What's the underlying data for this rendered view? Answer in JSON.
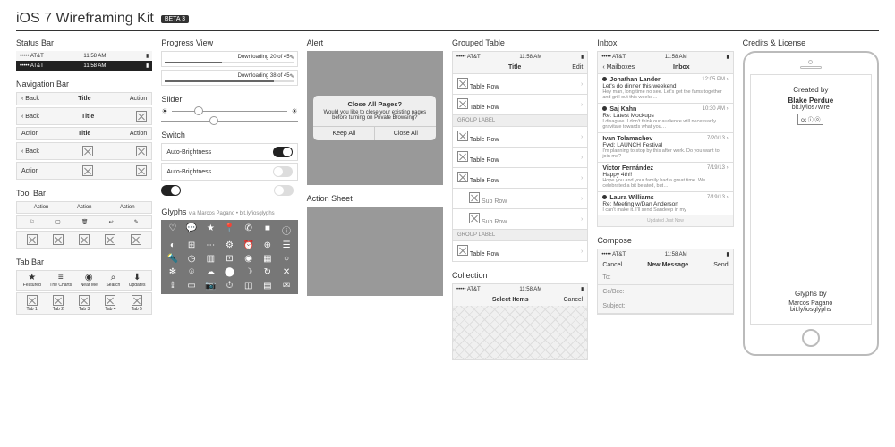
{
  "header": {
    "title": "iOS 7 Wireframing Kit",
    "badge": "BETA 3"
  },
  "sections": {
    "statusbar": "Status Bar",
    "navbar": "Navigation Bar",
    "toolbar": "Tool Bar",
    "tabbar": "Tab Bar",
    "progress": "Progress View",
    "slider": "Slider",
    "switch": "Switch",
    "glyphs": "Glyphs",
    "alert": "Alert",
    "actionsheet": "Action Sheet",
    "grouped": "Grouped Table",
    "collection": "Collection",
    "inbox": "Inbox",
    "compose": "Compose",
    "credits": "Credits & License"
  },
  "statusbar": {
    "carrier": "••••• AT&T",
    "wifi": "⦿",
    "time": "11:58 AM"
  },
  "navbar": {
    "back": "Back",
    "title": "Title",
    "action": "Action"
  },
  "toolbar": {
    "action": "Action"
  },
  "tabbar": {
    "labeled": [
      {
        "icon": "★",
        "label": "Featured"
      },
      {
        "icon": "≡",
        "label": "The Charts"
      },
      {
        "icon": "◉",
        "label": "Near Me"
      },
      {
        "icon": "⌕",
        "label": "Search"
      },
      {
        "icon": "⬇",
        "label": "Updates"
      }
    ],
    "generic": [
      "Tab 1",
      "Tab 2",
      "Tab 3",
      "Tab 4",
      "Tab 5"
    ]
  },
  "progress": [
    {
      "label": "Downloading 20 of 45",
      "pct": 44
    },
    {
      "label": "Downloading 38 of 45",
      "pct": 84
    }
  ],
  "switch": {
    "label": "Auto-Brightness"
  },
  "glyphs_credit": "via Marcos Pagano • bit.ly/iosglyphs",
  "alert": {
    "title": "Close All Pages?",
    "message": "Would you like to close your existing pages before turning on Private Browsing?",
    "buttons": [
      "Keep All",
      "Close All"
    ]
  },
  "grouped": {
    "nav_title": "Title",
    "nav_edit": "Edit",
    "row": "Table Row",
    "sub": "Sub Row",
    "label": "GROUP LABEL"
  },
  "collection": {
    "title": "Select Items",
    "cancel": "Cancel"
  },
  "inbox": {
    "back": "Mailboxes",
    "title": "Inbox",
    "items": [
      {
        "unread": true,
        "name": "Jonathan Lander",
        "time": "12:05 PM",
        "subj": "Let's do dinner this weekend",
        "prev": "Hey man, long time no see. Let's get the fams together and grill out this weeke…"
      },
      {
        "unread": true,
        "name": "Saj Kahn",
        "time": "10:30 AM",
        "subj": "Re: Latest Mockups",
        "prev": "I disagree. I don't think our audience will necessarily gravitate towards what you…"
      },
      {
        "unread": false,
        "name": "Ivan Tolamachev",
        "time": "7/20/13",
        "subj": "Fwd: LAUNCH Festival",
        "prev": "I'm planning to stop by this after work. Do you want to join me?"
      },
      {
        "unread": false,
        "name": "Victor Fernández",
        "time": "7/19/13",
        "subj": "Happy 4th!!",
        "prev": "Hope you and your family had a great time. We celebrated a bit belated, but…"
      },
      {
        "unread": true,
        "name": "Laura Williams",
        "time": "7/19/13",
        "subj": "Re: Meeting w/Dan Anderson",
        "prev": "I can't make it. I'll send Sandeep in my"
      }
    ],
    "footer": "Updated Just Now"
  },
  "compose": {
    "cancel": "Cancel",
    "title": "New Message",
    "send": "Send",
    "fields": [
      "To:",
      "Cc/Bcc:",
      "Subject:"
    ]
  },
  "credits": {
    "created_by_label": "Created by",
    "author": "Blake Perdue",
    "author_link": "bit.ly/ios7wire",
    "glyphs_by_label": "Glyphs by",
    "glyphs_author": "Marcos Pagano",
    "glyphs_link": "bit.ly/iosglyphs"
  }
}
